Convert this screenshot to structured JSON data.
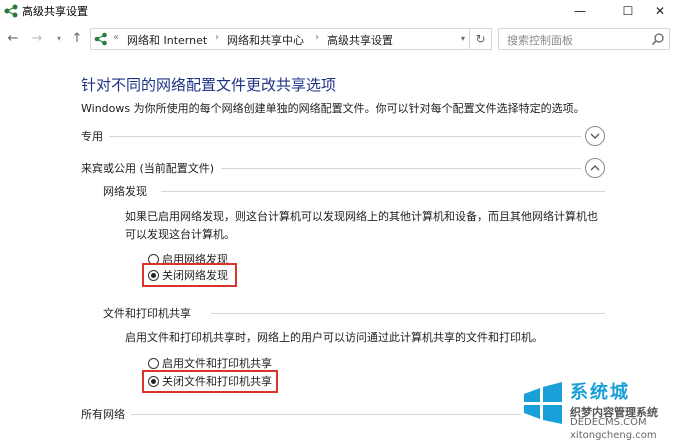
{
  "window": {
    "title": "高级共享设置",
    "min_glyph": "—",
    "max_glyph": "☐",
    "close_glyph": "✕"
  },
  "nav": {
    "back_glyph": "←",
    "forward_glyph": "→",
    "dropdown_glyph": "▾",
    "up_glyph": "↑",
    "overflow": "«",
    "breadcrumbs": [
      "网络和 Internet",
      "网络和共享中心",
      "高级共享设置"
    ],
    "separator": "›",
    "refresh_glyph": "↻",
    "search_placeholder": "搜索控制面板"
  },
  "page": {
    "heading": "针对不同的网络配置文件更改共享选项",
    "description": "Windows 为你所使用的每个网络创建单独的网络配置文件。你可以针对每个配置文件选择特定的选项。"
  },
  "profiles": {
    "private": {
      "label": "专用",
      "expanded": false
    },
    "guest": {
      "label": "来宾或公用 (当前配置文件)",
      "expanded": true
    },
    "all": {
      "label": "所有网络"
    }
  },
  "network_discovery": {
    "label": "网络发现",
    "description_line1": "如果已启用网络发现，则这台计算机可以发现网络上的其他计算机和设备，而且其他网络计算机也",
    "description_line2": "可以发现这台计算机。",
    "option_on": "启用网络发现",
    "option_off": "关闭网络发现",
    "selected": "off"
  },
  "file_printer_sharing": {
    "label": "文件和打印机共享",
    "description": "启用文件和打印机共享时，网络上的用户可以访问通过此计算机共享的文件和打印机。",
    "option_on": "启用文件和打印机共享",
    "option_off": "关闭文件和打印机共享",
    "selected": "off"
  },
  "watermark": {
    "name": "系统城",
    "line1": "织梦内容管理系统",
    "line2": "DEDECMS.COM",
    "line3": "xitongcheng.com"
  },
  "colors": {
    "heading": "#1e3287",
    "highlight_box": "#d9342b",
    "watermark_blue": "#1aa0d8"
  }
}
